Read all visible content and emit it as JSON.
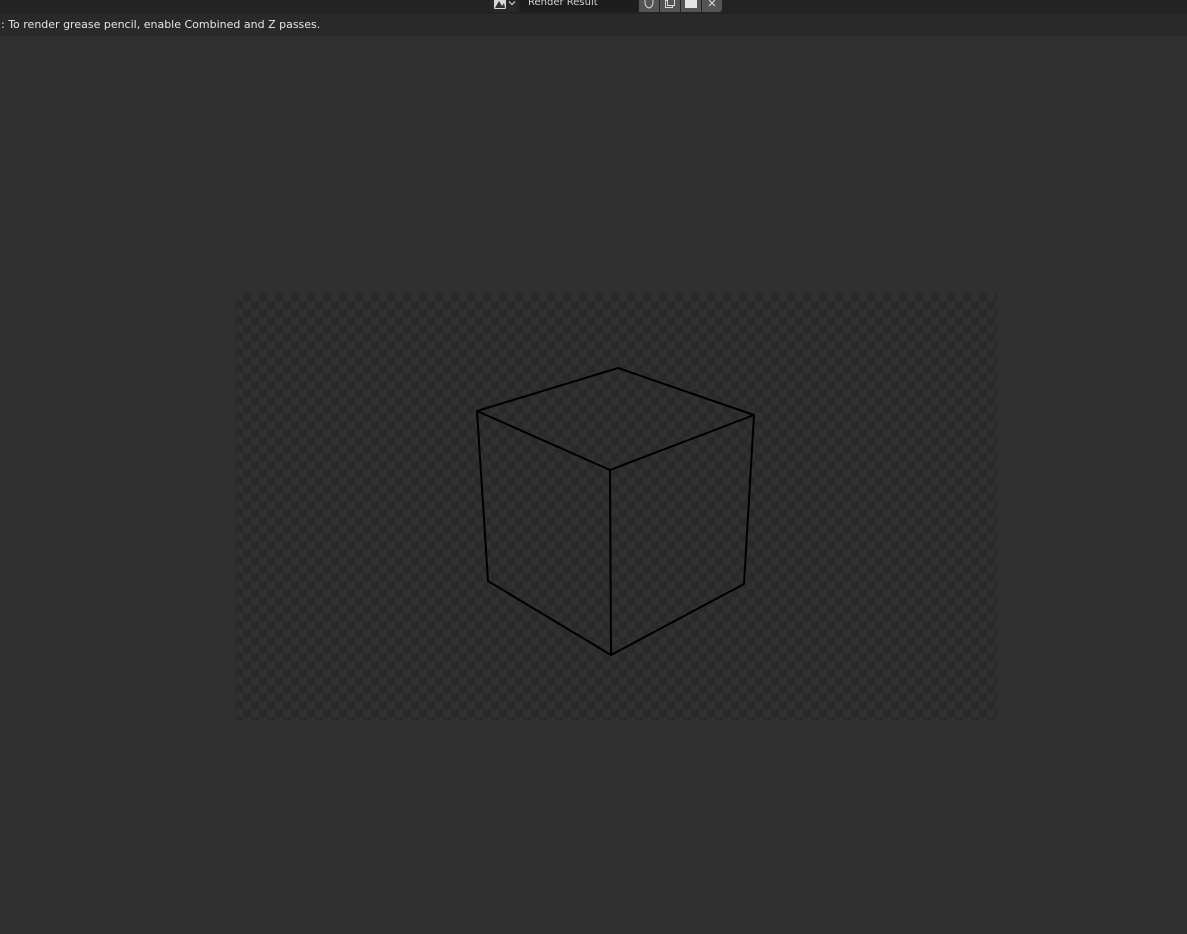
{
  "header": {
    "editor_type_icon": "image-editor-icon",
    "image_name": "Render Result",
    "buttons": [
      {
        "icon": "fake-user-shield-icon"
      },
      {
        "icon": "duplicate-image-icon"
      },
      {
        "icon": "new-image-icon"
      },
      {
        "icon": "close-icon",
        "glyph": "✕"
      }
    ]
  },
  "info": {
    "message": ": To render grease pencil, enable Combined and Z passes."
  },
  "render": {
    "object": "cube-wireframe",
    "line_color": "#000000",
    "transparent_background": true
  },
  "colors": {
    "background": "#303030",
    "header": "#232323",
    "info_bar": "#292929",
    "checker_dark": "#2a2a2a"
  }
}
